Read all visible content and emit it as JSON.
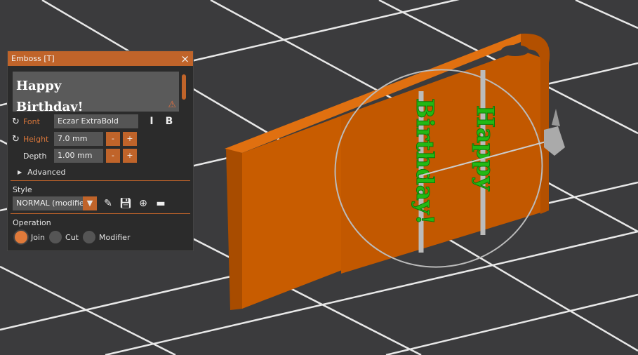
{
  "panel": {
    "title": "Emboss [T]",
    "close": "×",
    "text_lines": [
      "Happy",
      "Birthday!"
    ],
    "font_label": "Font",
    "font_value": "Eczar ExtraBold",
    "height_label": "Height",
    "height_value": "7.0 mm",
    "depth_label": "Depth",
    "depth_value": "1.00 mm",
    "minus": "-",
    "plus": "+",
    "advanced": "Advanced",
    "style_label": "Style",
    "style_value": "NORMAL (modified)",
    "operation_label": "Operation",
    "operations": [
      "Join",
      "Cut",
      "Modifier"
    ],
    "selected_operation": "Join"
  },
  "scene": {
    "emboss_text_1": "Happy",
    "emboss_text_2": "Birthday!"
  },
  "colors": {
    "accent": "#c0642a",
    "model": "#c85c00",
    "text_mesh": "#22b814"
  }
}
